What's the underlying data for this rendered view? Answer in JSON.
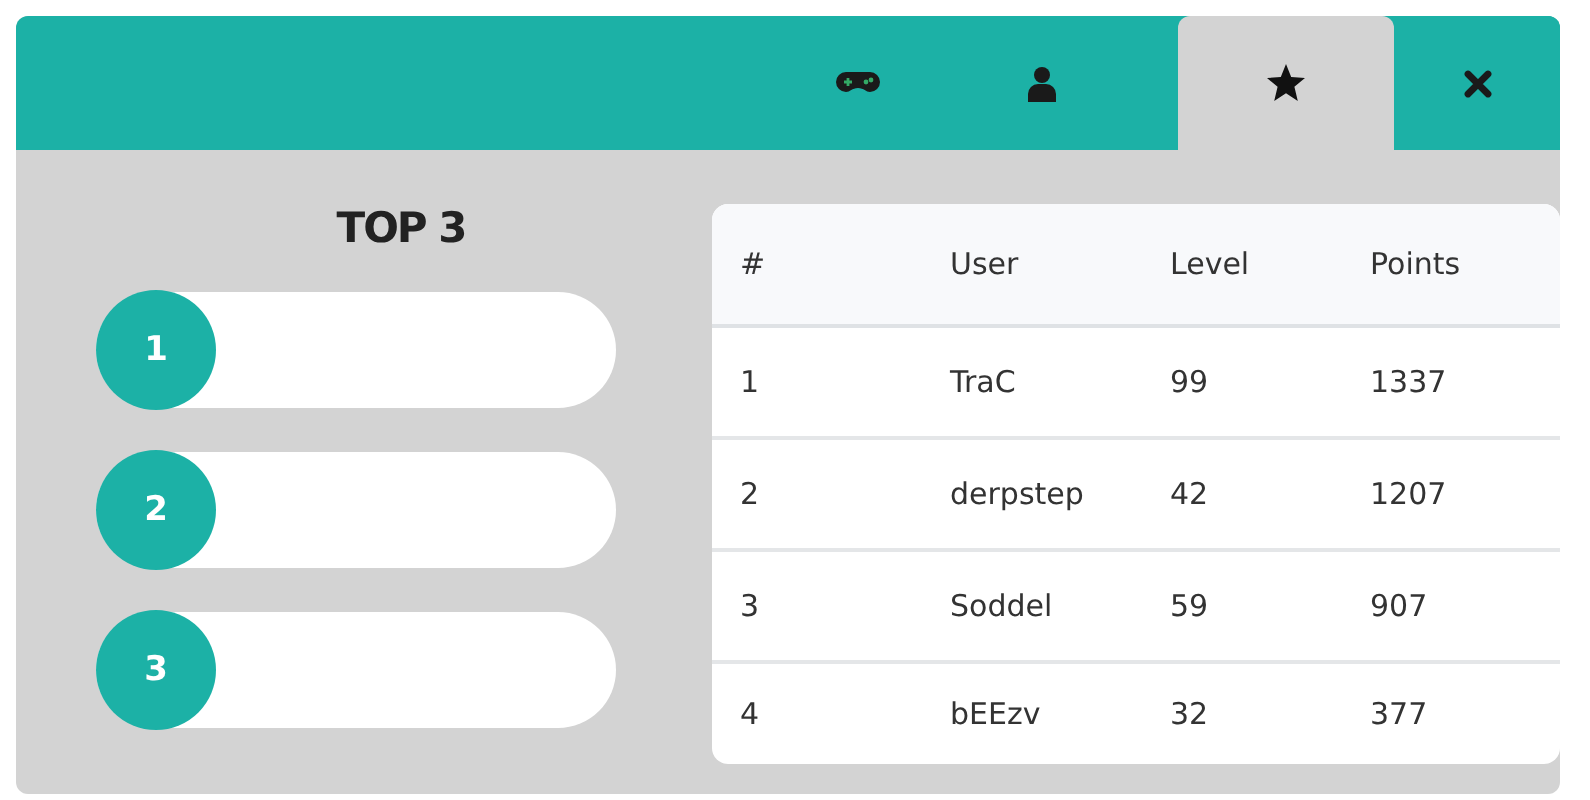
{
  "tabs": [
    {
      "kind": "gamepad",
      "selected": false
    },
    {
      "kind": "user",
      "selected": false
    },
    {
      "kind": "star",
      "selected": true
    }
  ],
  "close_button": {
    "kind": "close"
  },
  "top3": {
    "title": "TOP 3",
    "entries": [
      {
        "rank": "1"
      },
      {
        "rank": "2"
      },
      {
        "rank": "3"
      }
    ]
  },
  "table": {
    "columns": [
      "#",
      "User",
      "Level",
      "Points"
    ],
    "rows": [
      [
        "1",
        "TraC",
        "99",
        "1337"
      ],
      [
        "2",
        "derpstep",
        "42",
        "1207"
      ],
      [
        "3",
        "Soddel",
        "59",
        "907"
      ],
      [
        "4",
        "bEEzv",
        "32",
        "377"
      ]
    ]
  }
}
